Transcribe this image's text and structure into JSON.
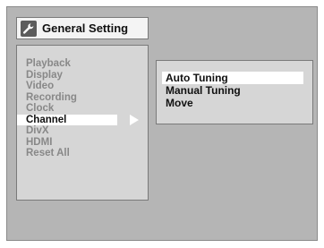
{
  "window": {
    "title": "General Setting",
    "icon": "wrench-icon"
  },
  "menu": {
    "items": [
      {
        "label": "Playback",
        "state": "inactive"
      },
      {
        "label": "Display",
        "state": "inactive"
      },
      {
        "label": "Video",
        "state": "inactive"
      },
      {
        "label": "Recording",
        "state": "inactive"
      },
      {
        "label": "Clock",
        "state": "inactive"
      },
      {
        "label": "Channel",
        "state": "selected"
      },
      {
        "label": "DivX",
        "state": "inactive"
      },
      {
        "label": "HDMI",
        "state": "inactive"
      },
      {
        "label": "Reset All",
        "state": "inactive"
      }
    ]
  },
  "submenu": {
    "items": [
      {
        "label": "Auto Tuning",
        "state": "highlighted"
      },
      {
        "label": "Manual Tuning",
        "state": "normal"
      },
      {
        "label": "Move",
        "state": "normal"
      }
    ]
  },
  "colors": {
    "background": "#b5b5b5",
    "panel": "#d6d6d6",
    "highlight": "#ffffff",
    "text_active": "#111111",
    "text_inactive": "#888888"
  }
}
